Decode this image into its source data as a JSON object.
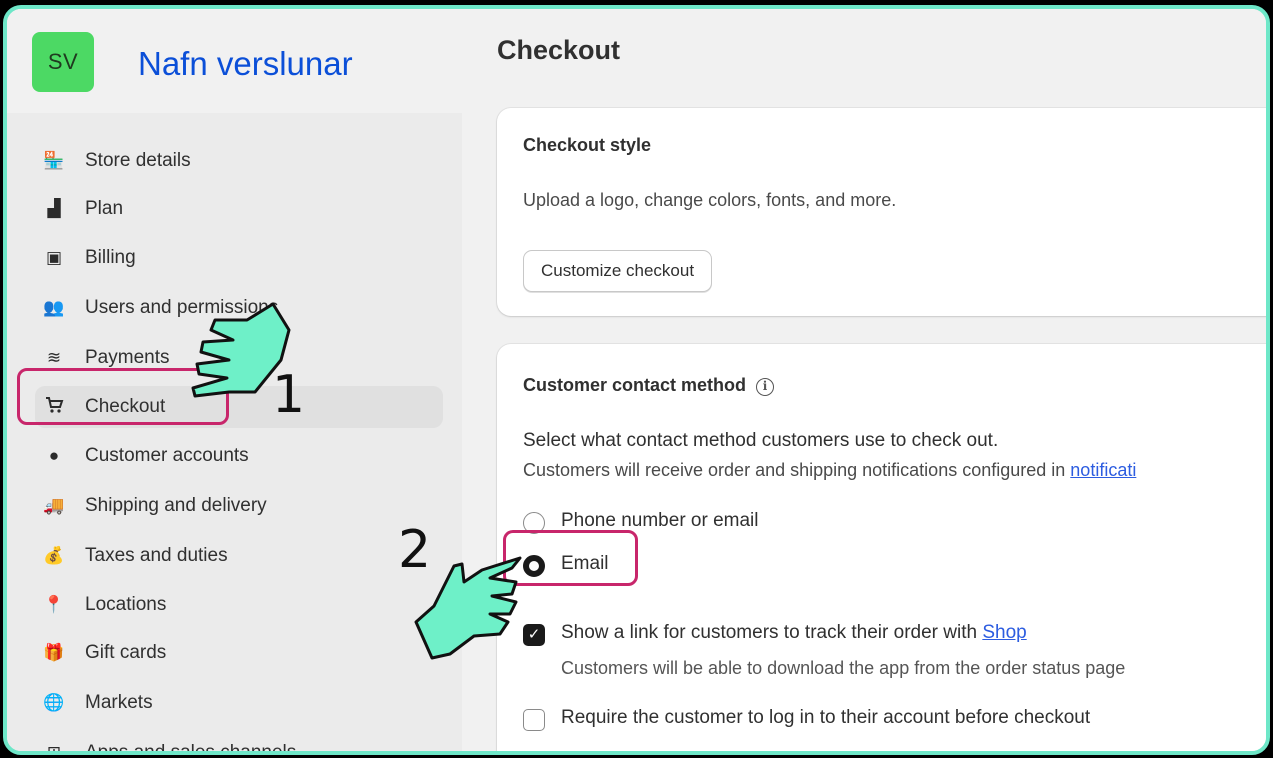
{
  "store": {
    "initials": "SV",
    "name": "Nafn verslunar"
  },
  "sidebar": {
    "items": [
      {
        "label": "Store details",
        "icon": "store-icon"
      },
      {
        "label": "Plan",
        "icon": "plan-icon"
      },
      {
        "label": "Billing",
        "icon": "billing-icon"
      },
      {
        "label": "Users and permissions",
        "icon": "users-icon"
      },
      {
        "label": "Payments",
        "icon": "payments-icon"
      },
      {
        "label": "Checkout",
        "icon": "cart-icon",
        "active": true
      },
      {
        "label": "Customer accounts",
        "icon": "person-icon"
      },
      {
        "label": "Shipping and delivery",
        "icon": "truck-icon"
      },
      {
        "label": "Taxes and duties",
        "icon": "tax-icon"
      },
      {
        "label": "Locations",
        "icon": "location-pin-icon"
      },
      {
        "label": "Gift cards",
        "icon": "gift-card-icon"
      },
      {
        "label": "Markets",
        "icon": "globe-icon"
      },
      {
        "label": "Apps and sales channels",
        "icon": "apps-icon"
      }
    ]
  },
  "main": {
    "title": "Checkout",
    "checkout_style": {
      "title": "Checkout style",
      "description": "Upload a logo, change colors, fonts, and more.",
      "button": "Customize checkout"
    },
    "contact_method": {
      "title": "Customer contact method",
      "prompt": "Select what contact method customers use to check out.",
      "description_prefix": "Customers will receive order and shipping notifications configured in",
      "description_link": "notificati",
      "options": [
        {
          "label": "Phone number or email",
          "selected": false
        },
        {
          "label": "Email",
          "selected": true
        }
      ],
      "shop_link_checkbox": {
        "label_prefix": "Show a link for customers to track their order with",
        "label_link": "Shop",
        "checked": true,
        "help": "Customers will be able to download the app from the order status page"
      },
      "require_login_checkbox": {
        "label": "Require the customer to log in to their account before checkout",
        "checked": false
      }
    }
  },
  "annotations": {
    "step1": "1",
    "step2": "2"
  },
  "colors": {
    "highlight": "#c8266b",
    "hand": "#6ef0c8",
    "frame": "#6ee7c8",
    "avatar": "#4cd964",
    "link": "#2c5ce0"
  }
}
